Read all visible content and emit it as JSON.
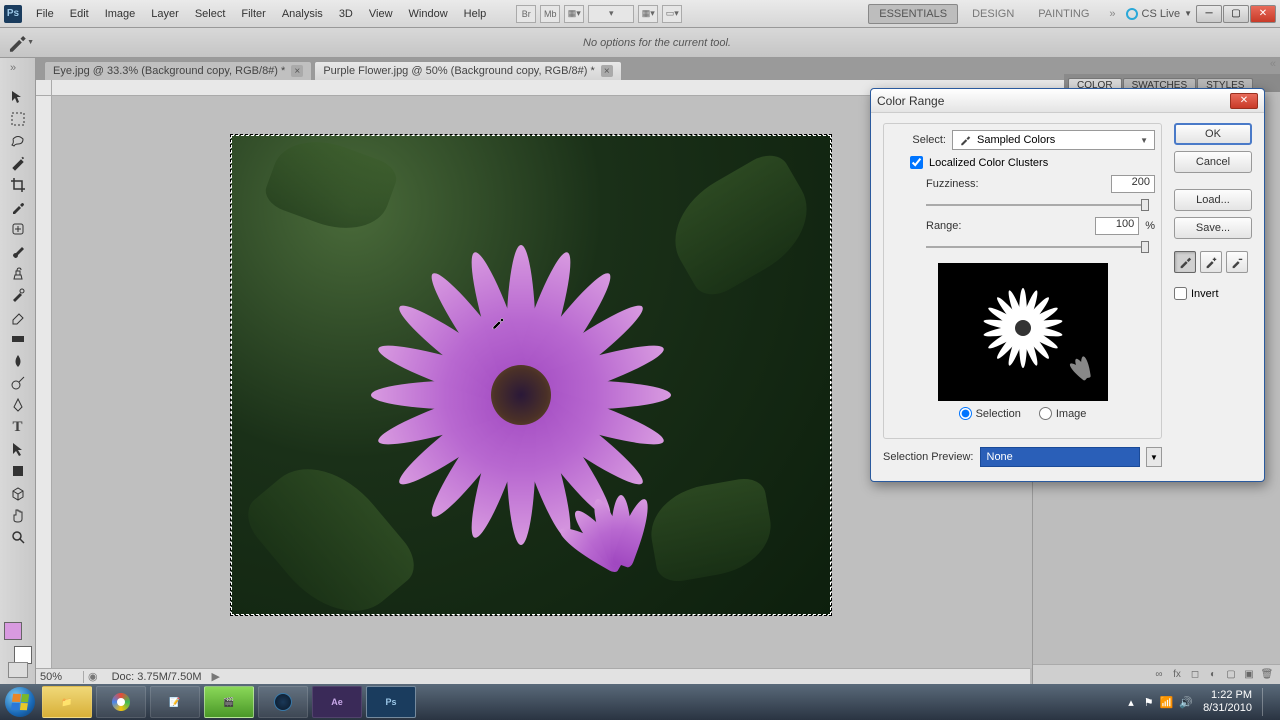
{
  "app": {
    "logo": "Ps"
  },
  "menu": [
    "File",
    "Edit",
    "Image",
    "Layer",
    "Select",
    "Filter",
    "Analysis",
    "3D",
    "View",
    "Window",
    "Help"
  ],
  "workspaces": {
    "items": [
      "ESSENTIALS",
      "DESIGN",
      "PAINTING"
    ],
    "cslive": "CS Live"
  },
  "options": {
    "text": "No options for the current tool."
  },
  "tabs": [
    {
      "label": "Eye.jpg @ 33.3% (Background copy, RGB/8#) *"
    },
    {
      "label": "Purple Flower.jpg @ 50% (Background copy, RGB/8#) *"
    }
  ],
  "status": {
    "zoom": "50%",
    "doc": "Doc: 3.75M/7.50M"
  },
  "panel_tabs": [
    "COLOR",
    "SWATCHES",
    "STYLES"
  ],
  "swatch_color": "#d89ae0",
  "dialog": {
    "title": "Color Range",
    "select_label": "Select:",
    "select_value": "Sampled Colors",
    "localized_label": "Localized Color Clusters",
    "fuzziness_label": "Fuzziness:",
    "fuzziness_value": "200",
    "range_label": "Range:",
    "range_value": "100",
    "range_unit": "%",
    "radio_selection": "Selection",
    "radio_image": "Image",
    "selprev_label": "Selection Preview:",
    "selprev_value": "None",
    "ok": "OK",
    "cancel": "Cancel",
    "load": "Load...",
    "save": "Save...",
    "invert": "Invert"
  },
  "taskbar": {
    "items": [
      "📁",
      "🌐",
      "📝",
      "🎬",
      "💿",
      "Ae",
      "Ps"
    ],
    "time": "1:22 PM",
    "date": "8/31/2010"
  }
}
